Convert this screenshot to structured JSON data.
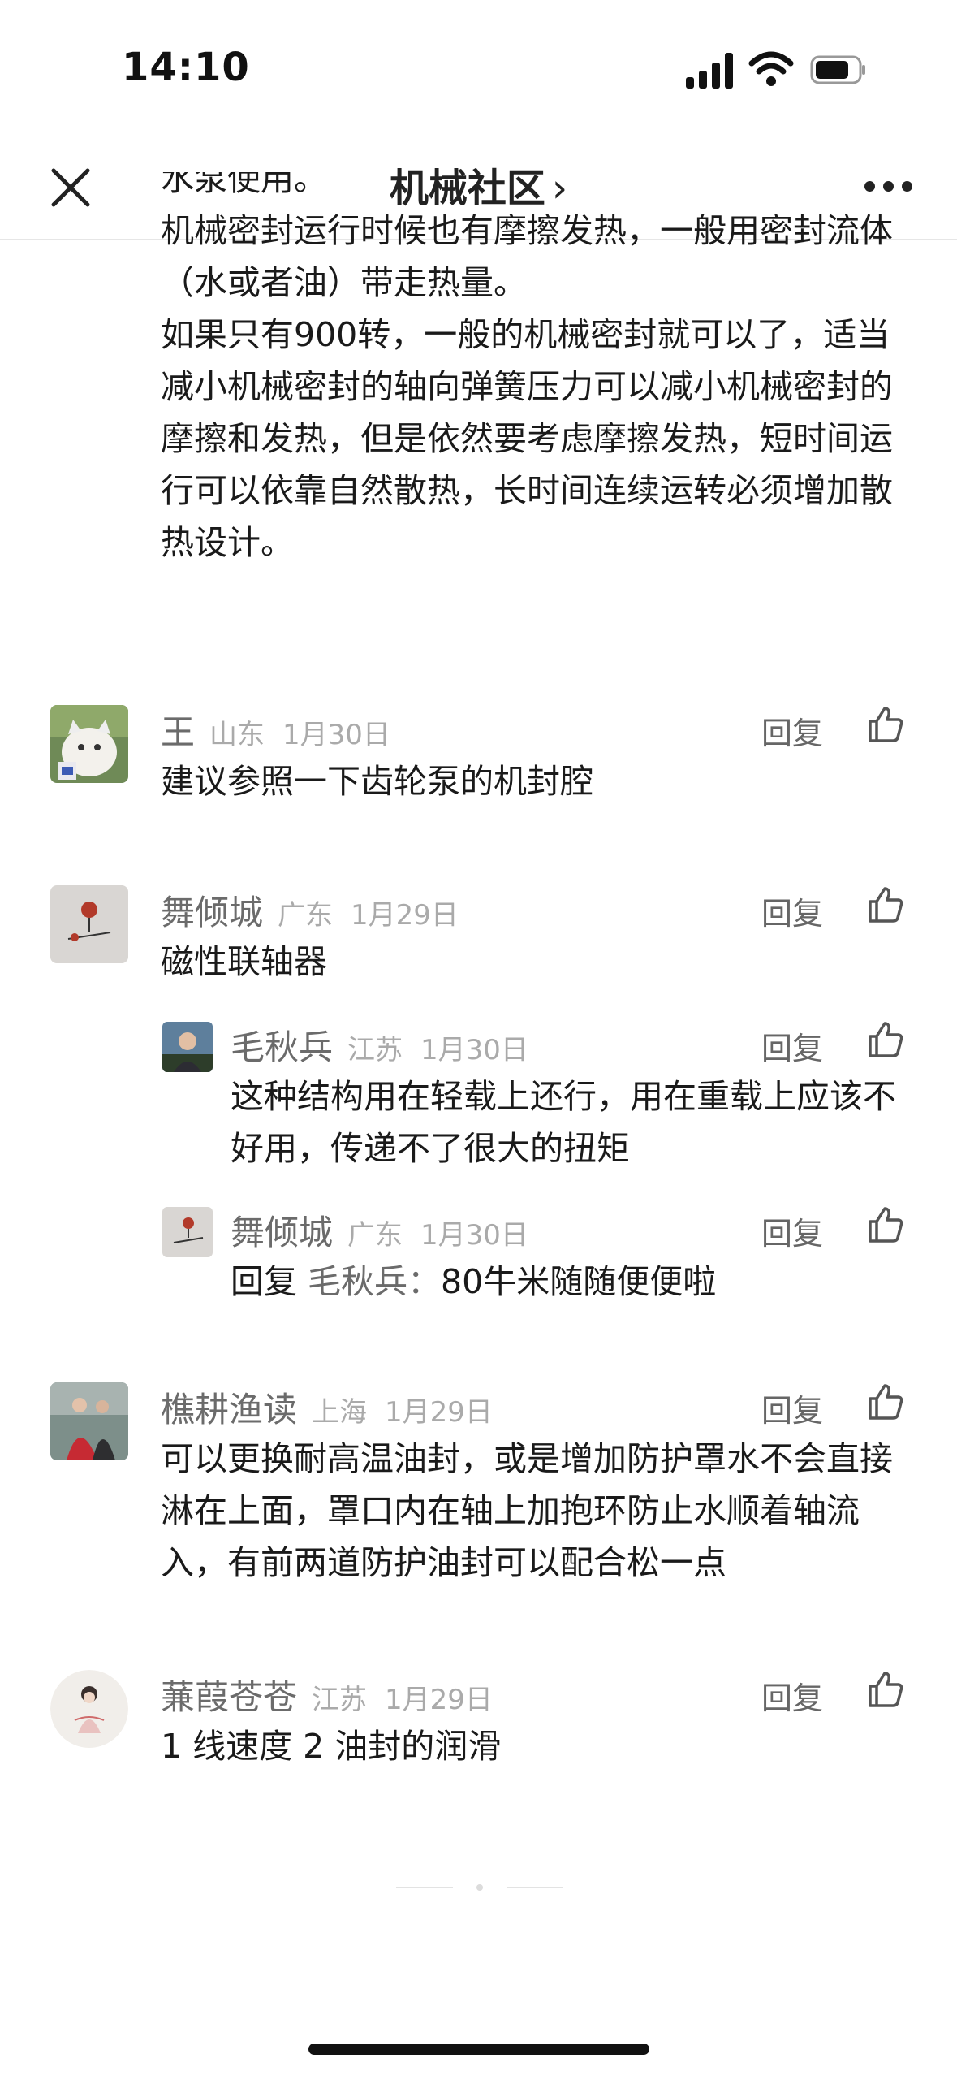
{
  "status_bar": {
    "time": "14:10"
  },
  "nav": {
    "title": "机械社区",
    "chevron": "›"
  },
  "post": {
    "clipped_line": "水泵使用。",
    "paragraphs": [
      "机械密封运行时候也有摩擦发热，一般用密封流体（水或者油）带走热量。",
      "如果只有900转，一般的机械密封就可以了，适当减小机械密封的轴向弹簧压力可以减小机械密封的摩擦和发热，但是依然要考虑摩擦发热，短时间运行可以依靠自然散热，长时间连续运转必须增加散热设计。"
    ]
  },
  "reply_label": "回复",
  "comments": [
    {
      "name": "王",
      "location": "山东",
      "date": "1月30日",
      "text": "建议参照一下齿轮泵的机封腔",
      "avatar_icon": "cat-avatar"
    },
    {
      "name": "舞倾城",
      "location": "广东",
      "date": "1月29日",
      "text": "磁性联轴器",
      "avatar_icon": "ornament-avatar",
      "replies": [
        {
          "name": "毛秋兵",
          "location": "江苏",
          "date": "1月30日",
          "text": "这种结构用在轻载上还行，用在重载上应该不好用，传递不了很大的扭矩",
          "avatar_icon": "man-avatar"
        },
        {
          "name": "舞倾城",
          "location": "广东",
          "date": "1月30日",
          "reply_prefix": "回复",
          "reply_to": "毛秋兵：",
          "text": "80牛米随随便便啦",
          "avatar_icon": "ornament-avatar"
        }
      ]
    },
    {
      "name": "樵耕渔读",
      "location": "上海",
      "date": "1月29日",
      "text": "可以更换耐高温油封，或是增加防护罩水不会直接淋在上面，罩口内在轴上加抱环防止水顺着轴流入，有前两道防护油封可以配合松一点",
      "avatar_icon": "couple-avatar"
    },
    {
      "name": "蒹葭苍苍",
      "location": "江苏",
      "date": "1月29日",
      "text": "1 线速度 2 油封的润滑",
      "avatar_icon": "lady-avatar"
    }
  ],
  "colors": {
    "text": "#1a1a1a",
    "meta": "#6b6b6b",
    "muted": "#aaaaaa"
  }
}
